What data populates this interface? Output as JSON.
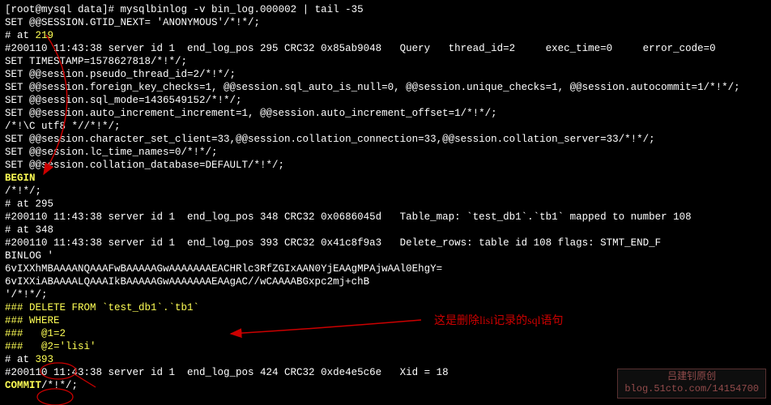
{
  "prompt": "[root@mysql data]# ",
  "command": "mysqlbinlog -v bin_log.000002 | tail -35",
  "lines": {
    "l01": "SET @@SESSION.GTID_NEXT= 'ANONYMOUS'/*!*/;",
    "l02a": "# at ",
    "l02b": "219",
    "l03": "#200110 11:43:38 server id 1  end_log_pos 295 CRC32 0x85ab9048   Query   thread_id=2     exec_time=0     error_code=0",
    "l04": "SET TIMESTAMP=1578627818/*!*/;",
    "l05": "SET @@session.pseudo_thread_id=2/*!*/;",
    "l06": "SET @@session.foreign_key_checks=1, @@session.sql_auto_is_null=0, @@session.unique_checks=1, @@session.autocommit=1/*!*/;",
    "l07": "SET @@session.sql_mode=1436549152/*!*/;",
    "l08": "SET @@session.auto_increment_increment=1, @@session.auto_increment_offset=1/*!*/;",
    "l09": "/*!\\C utf8 *//*!*/;",
    "l10": "SET @@session.character_set_client=33,@@session.collation_connection=33,@@session.collation_server=33/*!*/;",
    "l11": "SET @@session.lc_time_names=0/*!*/;",
    "l12": "SET @@session.collation_database=DEFAULT/*!*/;",
    "l13": "BEGIN",
    "l14": "/*!*/;",
    "l15": "# at 295",
    "l16": "#200110 11:43:38 server id 1  end_log_pos 348 CRC32 0x0686045d   Table_map: `test_db1`.`tb1` mapped to number 108",
    "l17": "# at 348",
    "l18": "#200110 11:43:38 server id 1  end_log_pos 393 CRC32 0x41c8f9a3   Delete_rows: table id 108 flags: STMT_END_F",
    "l19": "",
    "l20": "BINLOG '",
    "l21": "6vIXXhMBAAAANQAAAFwBAAAAAGwAAAAAAAEACHRlc3RfZGIxAAN0YjEAAgMPAjwAAl0EhgY=",
    "l22": "6vIXXiABAAAALQAAAIkBAAAAAGwAAAAAAAEAAgAC//wCAAAABGxpc2mj+chB",
    "l23": "'/*!*/;",
    "l24": "### DELETE FROM `test_db1`.`tb1`",
    "l25": "### WHERE",
    "l26": "###   @1=2",
    "l27": "###   @2='lisi'",
    "l28a": "# at ",
    "l28b": "393",
    "l29": "#200110 11:43:38 server id 1  end_log_pos 424 CRC32 0xde4e5c6e   Xid = 18",
    "l30a": "COMMIT",
    "l30b": "/*!*/;"
  },
  "annotation": "这是删除lisi记录的sql语句",
  "watermark": {
    "author": "吕建钊原创",
    "url": "blog.51cto.com/14154700"
  }
}
